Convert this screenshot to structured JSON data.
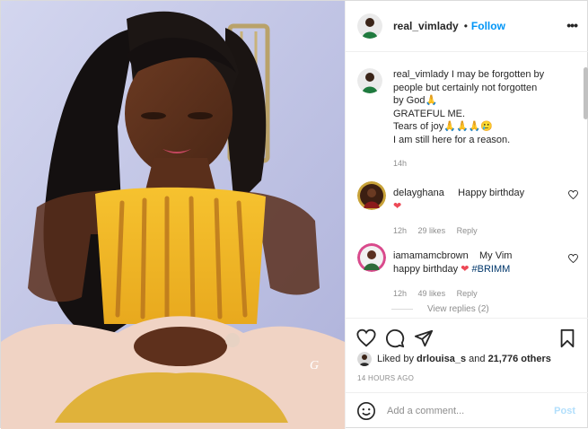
{
  "post": {
    "author": "real_vimlady",
    "follow_label": "Follow",
    "dot": "•",
    "more": "•••",
    "watermark": "G"
  },
  "caption": {
    "username": "real_vimlady",
    "lines": [
      "I may be forgotten by",
      "people but certainly not forgotten",
      "by God🙏",
      "GRATEFUL ME.",
      "Tears of joy🙏🙏🙏🥲",
      "I am still here for a reason."
    ],
    "time": "14h"
  },
  "comments": [
    {
      "username": "delayghana",
      "text": "Happy birthday",
      "emoji": "❤",
      "time": "12h",
      "likes": "29 likes",
      "reply": "Reply"
    },
    {
      "username": "iamamamcbrown",
      "text_a": "My Vim",
      "text_b": "happy birthday",
      "emoji": "❤",
      "hashtag": "#BRIMM",
      "time": "12h",
      "likes": "49 likes",
      "reply": "Reply"
    }
  ],
  "view_replies": "View replies (2)",
  "likes": {
    "prefix": "Liked by ",
    "user": "drlouisa_s",
    "middle": " and ",
    "count": "21,776 others"
  },
  "timestamp": "14 HOURS AGO",
  "add_comment": {
    "placeholder": "Add a comment...",
    "post_label": "Post"
  },
  "colors": {
    "link_blue": "#0095f6",
    "like_red": "#ed4956",
    "post_disabled": "#b2dffc"
  }
}
